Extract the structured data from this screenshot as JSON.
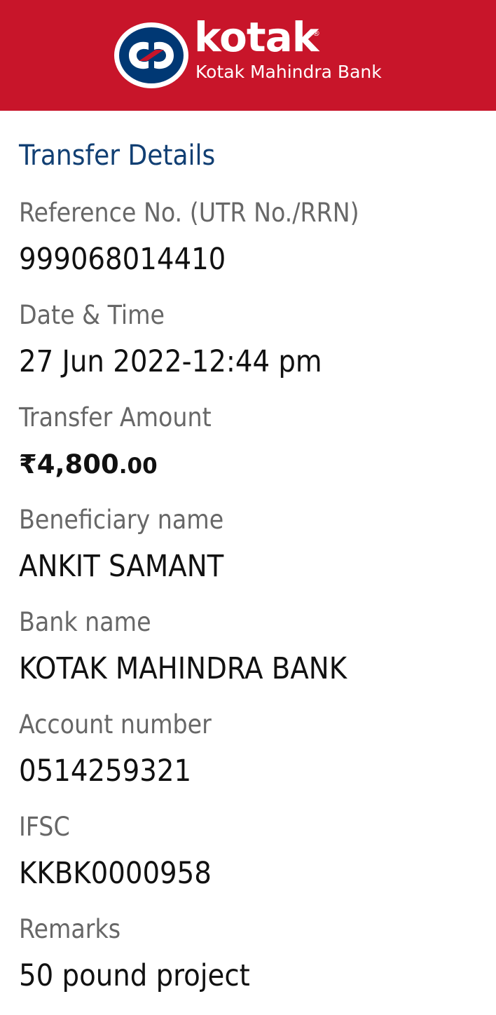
{
  "header": {
    "brand_name": "kotak",
    "brand_registered": "®",
    "brand_subtitle": "Kotak Mahindra Bank",
    "background_color": "#c8152a",
    "logo_icon": "kotak-logo-icon"
  },
  "section": {
    "title": "Transfer Details"
  },
  "fields": {
    "reference": {
      "label": "Reference No. (UTR No./RRN)",
      "value": "999068014410"
    },
    "date_time": {
      "label": "Date & Time",
      "value": "27 Jun 2022-12:44 pm"
    },
    "amount": {
      "label": "Transfer Amount",
      "value_main": "₹4,800",
      "value_decimal": ".00"
    },
    "beneficiary": {
      "label": "Beneficiary name",
      "value": "ANKIT SAMANT"
    },
    "bank": {
      "label": "Bank name",
      "value": "KOTAK MAHINDRA BANK"
    },
    "account": {
      "label": "Account number",
      "value": "0514259321"
    },
    "ifsc": {
      "label": "IFSC",
      "value": "KKBK0000958"
    },
    "remarks": {
      "label": "Remarks",
      "value": "50 pound project"
    }
  }
}
